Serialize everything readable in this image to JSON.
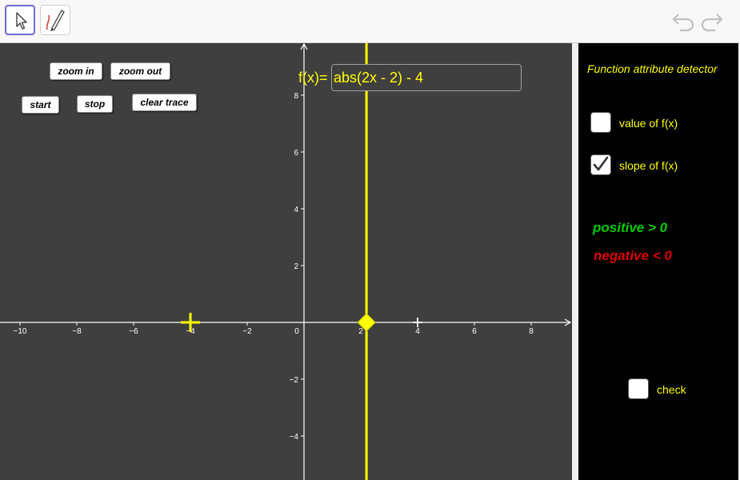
{
  "toolbar": {
    "tools": [
      {
        "name": "move-tool",
        "icon": "arrow-cursor-icon",
        "selected": true
      },
      {
        "name": "pen-tool",
        "icon": "pen-icon",
        "selected": false
      }
    ],
    "undo_icon": "undo-icon",
    "redo_icon": "redo-icon"
  },
  "graphics": {
    "buttons": {
      "zoom_in": "zoom in",
      "zoom_out": "zoom out",
      "start": "start",
      "stop": "stop",
      "clear_trace": "clear trace"
    },
    "function_label": "f(x)=",
    "function_value": "abs(2x - 2) - 4",
    "axes": {
      "x_ticks": [
        "-10",
        "-8",
        "-6",
        "-4",
        "-2",
        "0",
        "2",
        "4",
        "6",
        "8"
      ],
      "y_ticks_pos": [
        "2",
        "4",
        "6",
        "8"
      ],
      "y_ticks_neg": [
        "-2",
        "-4"
      ]
    },
    "vertical_line_x": 2.2,
    "point_x": 2.2,
    "trace_marker_x": -4,
    "white_marker_x": 4
  },
  "sidebar": {
    "title": "Function attribute detector",
    "value_label": "value of f(x)",
    "value_checked": false,
    "slope_label": "slope of f(x)",
    "slope_checked": true,
    "positive_text": "positive > 0",
    "negative_text": "negative < 0",
    "check_label": "check",
    "check_checked": false
  },
  "colors": {
    "background": "#3f3f3f",
    "function": "#ffff00",
    "positive": "#00cc00",
    "negative": "#dd0000"
  }
}
